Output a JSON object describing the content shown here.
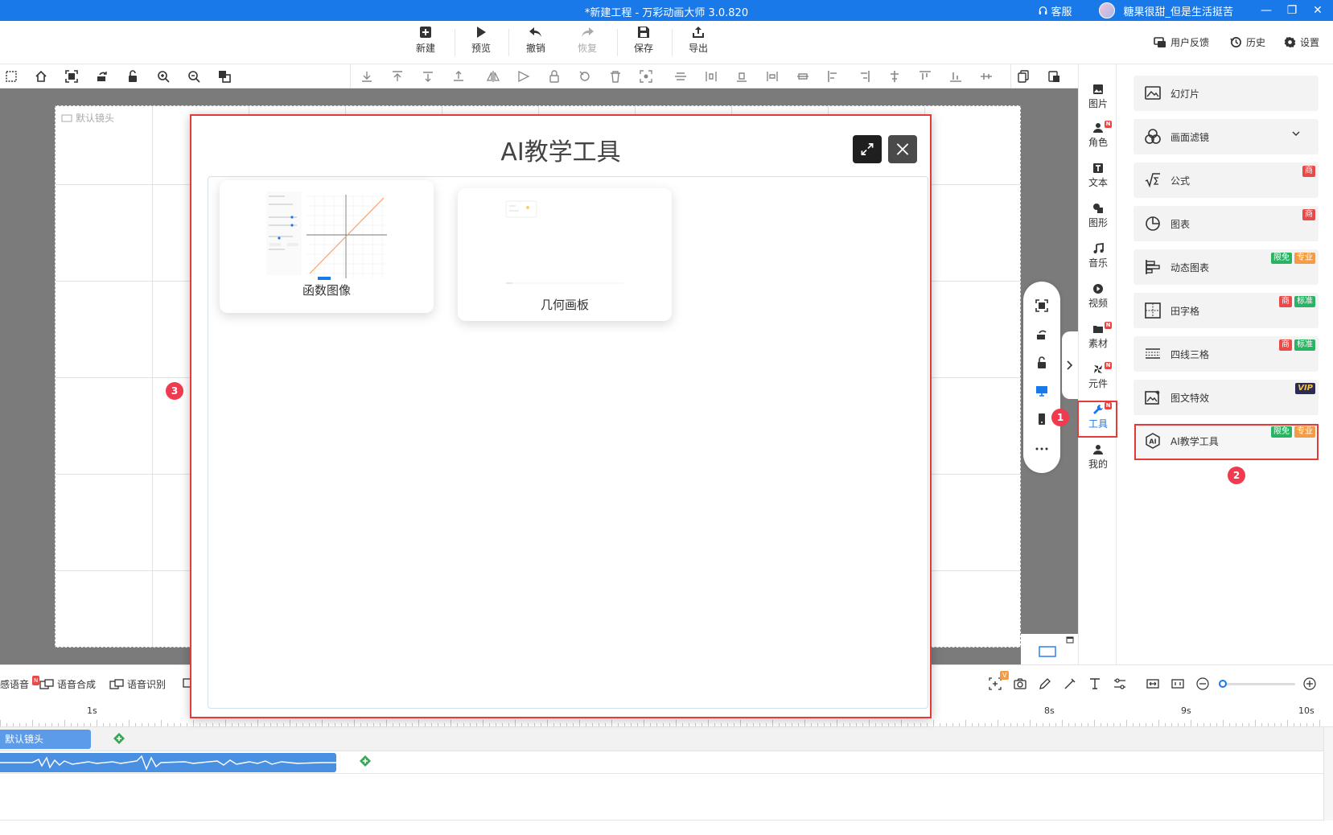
{
  "titlebar": {
    "title": "*新建工程 - 万彩动画大师 3.0.820",
    "support": "客服",
    "user": "糖果很甜_但是生活挺苦"
  },
  "toolbar": {
    "new": "新建",
    "preview": "预览",
    "undo": "撤销",
    "redo": "恢复",
    "save": "保存",
    "export": "导出",
    "feedback": "用户反馈",
    "history": "历史",
    "settings": "设置"
  },
  "canvas": {
    "camera_label": "默认镜头"
  },
  "icon_column": [
    {
      "label": "图片",
      "icon": "image-icon",
      "new": false
    },
    {
      "label": "角色",
      "icon": "person-icon",
      "new": true
    },
    {
      "label": "文本",
      "icon": "text-icon",
      "new": false
    },
    {
      "label": "图形",
      "icon": "shape-icon",
      "new": false
    },
    {
      "label": "音乐",
      "icon": "music-icon",
      "new": false
    },
    {
      "label": "视频",
      "icon": "video-icon",
      "new": false
    },
    {
      "label": "素材",
      "icon": "folder-icon",
      "new": true
    },
    {
      "label": "元件",
      "icon": "component-icon",
      "new": true
    },
    {
      "label": "工具",
      "icon": "wrench-icon",
      "new": true
    },
    {
      "label": "我的",
      "icon": "user-icon",
      "new": false
    }
  ],
  "new_badge": "N",
  "right_panel": {
    "items": [
      {
        "label": "幻灯片",
        "badges": []
      },
      {
        "label": "画面滤镜",
        "badges": []
      },
      {
        "label": "公式",
        "badges": [
          "商"
        ]
      },
      {
        "label": "图表",
        "badges": [
          "商"
        ]
      },
      {
        "label": "动态图表",
        "badges": [
          "限免",
          "专业"
        ]
      },
      {
        "label": "田字格",
        "badges": [
          "商",
          "标准"
        ]
      },
      {
        "label": "四线三格",
        "badges": [
          "商",
          "标准"
        ]
      },
      {
        "label": "图文特效",
        "badges": [
          "VIP"
        ]
      },
      {
        "label": "AI教学工具",
        "badges": [
          "限免",
          "专业"
        ]
      }
    ]
  },
  "steps": {
    "one": "1",
    "two": "2",
    "three": "3"
  },
  "modal": {
    "title": "AI教学工具",
    "cards": [
      {
        "label": "函数图像"
      },
      {
        "label": "几何画板"
      }
    ]
  },
  "timeline": {
    "speech_tail": "感语音",
    "speech_badge": "N",
    "tts": "语音合成",
    "asr": "语音识别",
    "ruler": [
      "1s",
      "8s",
      "9s",
      "10s"
    ],
    "camera_clip": "默认镜头",
    "v_badge": "V",
    "zoom_level": 0.05
  },
  "colors": {
    "accent": "#1a79e8",
    "highlight": "#e53a3a",
    "step": "#f03a4f",
    "canvas_bg": "#7b7b7b"
  }
}
